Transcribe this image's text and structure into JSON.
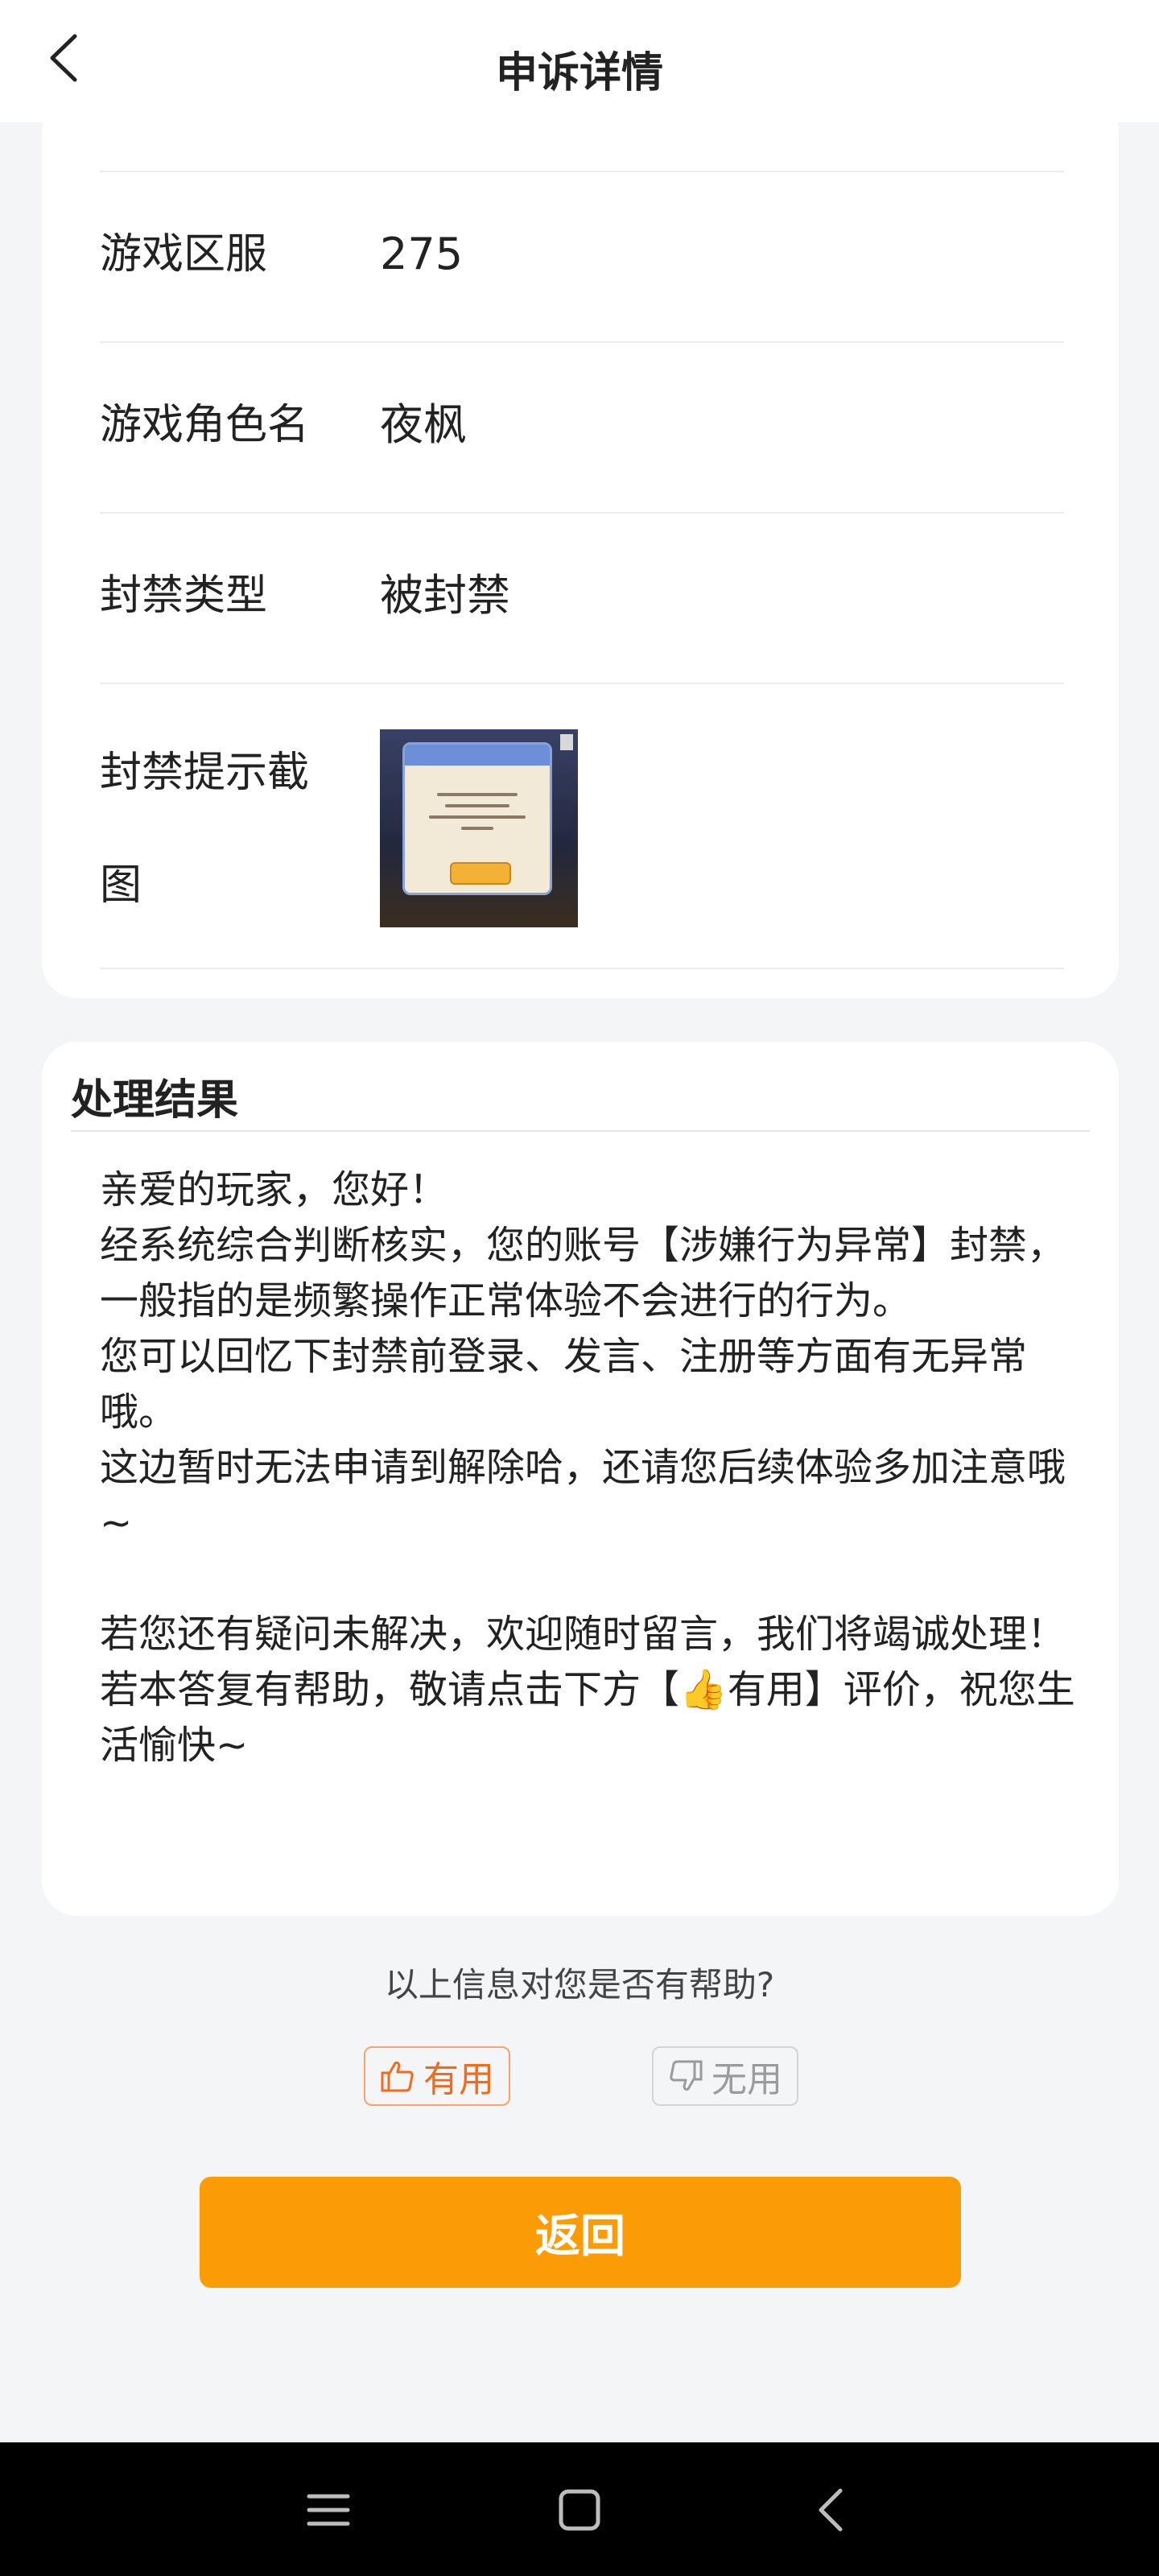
{
  "header": {
    "title": "申诉详情"
  },
  "details": {
    "rows": [
      {
        "label": "游戏区服",
        "value": "275"
      },
      {
        "label": "游戏角色名",
        "value": "夜枫"
      },
      {
        "label": "封禁类型",
        "value": "被封禁"
      }
    ],
    "screenshot_label": "封禁提示截图"
  },
  "result": {
    "title": "处理结果",
    "lines": [
      "亲爱的玩家，您好！",
      "经系统综合判断核实，您的账号【涉嫌行为异常】封禁，一般指的是频繁操作正常体验不会进行的行为。",
      "您可以回忆下封禁前登录、发言、注册等方面有无异常哦。",
      "这边暂时无法申请到解除哈，还请您后续体验多加注意哦~",
      "若您还有疑问未解决，欢迎随时留言，我们将竭诚处理！",
      "若本答复有帮助，敬请点击下方【👍有用】评价，祝您生活愉快~"
    ]
  },
  "feedback": {
    "question": "以上信息对您是否有帮助?",
    "useful_label": "有用",
    "useless_label": "无用"
  },
  "actions": {
    "return_label": "返回"
  },
  "colors": {
    "accent": "#fb9b05",
    "useful": "#f26b1d",
    "useless": "#9b9b9b",
    "background": "#f4f5f7"
  },
  "icons": {
    "back": "chevron-left-icon",
    "useful": "thumbs-up-icon",
    "useless": "thumbs-down-icon",
    "nav_menu": "menu-icon",
    "nav_home": "home-square-icon",
    "nav_back": "back-triangle-icon"
  }
}
